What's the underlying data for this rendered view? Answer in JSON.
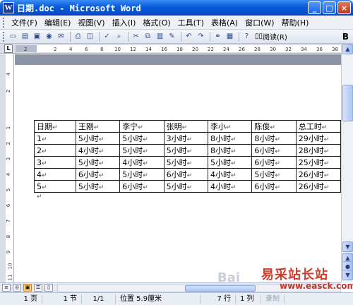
{
  "window": {
    "title": "日期.doc - Microsoft Word",
    "app_icon": "W",
    "buttons": {
      "minimize": "_",
      "maximize": "□",
      "close": "×"
    }
  },
  "menu": [
    "文件(F)",
    "编辑(E)",
    "视图(V)",
    "插入(I)",
    "格式(O)",
    "工具(T)",
    "表格(A)",
    "窗口(W)",
    "帮助(H)"
  ],
  "toolbar": {
    "read_label": "阅读(R)",
    "bold_label": "B",
    "icons": [
      "new-icon",
      "open-icon",
      "save-icon",
      "permission-icon",
      "email-icon",
      "print-icon",
      "print-preview-icon",
      "spelling-icon",
      "research-icon",
      "cut-icon",
      "copy-icon",
      "paste-icon",
      "format-painter-icon",
      "undo-icon",
      "redo-icon",
      "hyperlink-icon",
      "tables-borders-icon",
      "help-icon"
    ]
  },
  "ruler": {
    "corner": "L",
    "numbers": [
      "2",
      "2",
      "4",
      "6",
      "8",
      "10",
      "12",
      "14",
      "16",
      "18",
      "20",
      "22",
      "24",
      "26",
      "28",
      "30",
      "32",
      "34",
      "36",
      "38"
    ]
  },
  "vruler": {
    "numbers": [
      "4",
      "2",
      "1",
      "2",
      "3",
      "4",
      "5",
      "6",
      "7",
      "8",
      "9",
      "10",
      "11",
      "12"
    ]
  },
  "table": {
    "headers": [
      "日期",
      "王刚",
      "李宁",
      "张明",
      "李小",
      "陈俊",
      "总工时"
    ],
    "rows": [
      [
        "1",
        "5小时",
        "5小时",
        "3小时",
        "8小时",
        "8小时",
        "29小时"
      ],
      [
        "2",
        "4小时",
        "5小时",
        "5小时",
        "8小时",
        "6小时",
        "28小时"
      ],
      [
        "3",
        "5小时",
        "4小时",
        "5小时",
        "5小时",
        "6小时",
        "25小时"
      ],
      [
        "4",
        "6小时",
        "5小时",
        "6小时",
        "4小时",
        "5小时",
        "26小时"
      ],
      [
        "5",
        "5小时",
        "6小时",
        "5小时",
        "4小时",
        "6小时",
        "26小时"
      ]
    ],
    "mark": "↵"
  },
  "status": {
    "page": "1 页",
    "section": "1 节",
    "pages": "1/1",
    "position": "位置 5.9厘米",
    "line": "7 行",
    "column": "1 列",
    "rec": "录制"
  },
  "watermark": {
    "site_cn": "易采站长站",
    "site_url": "www.easck.com",
    "bai": "Bai"
  }
}
